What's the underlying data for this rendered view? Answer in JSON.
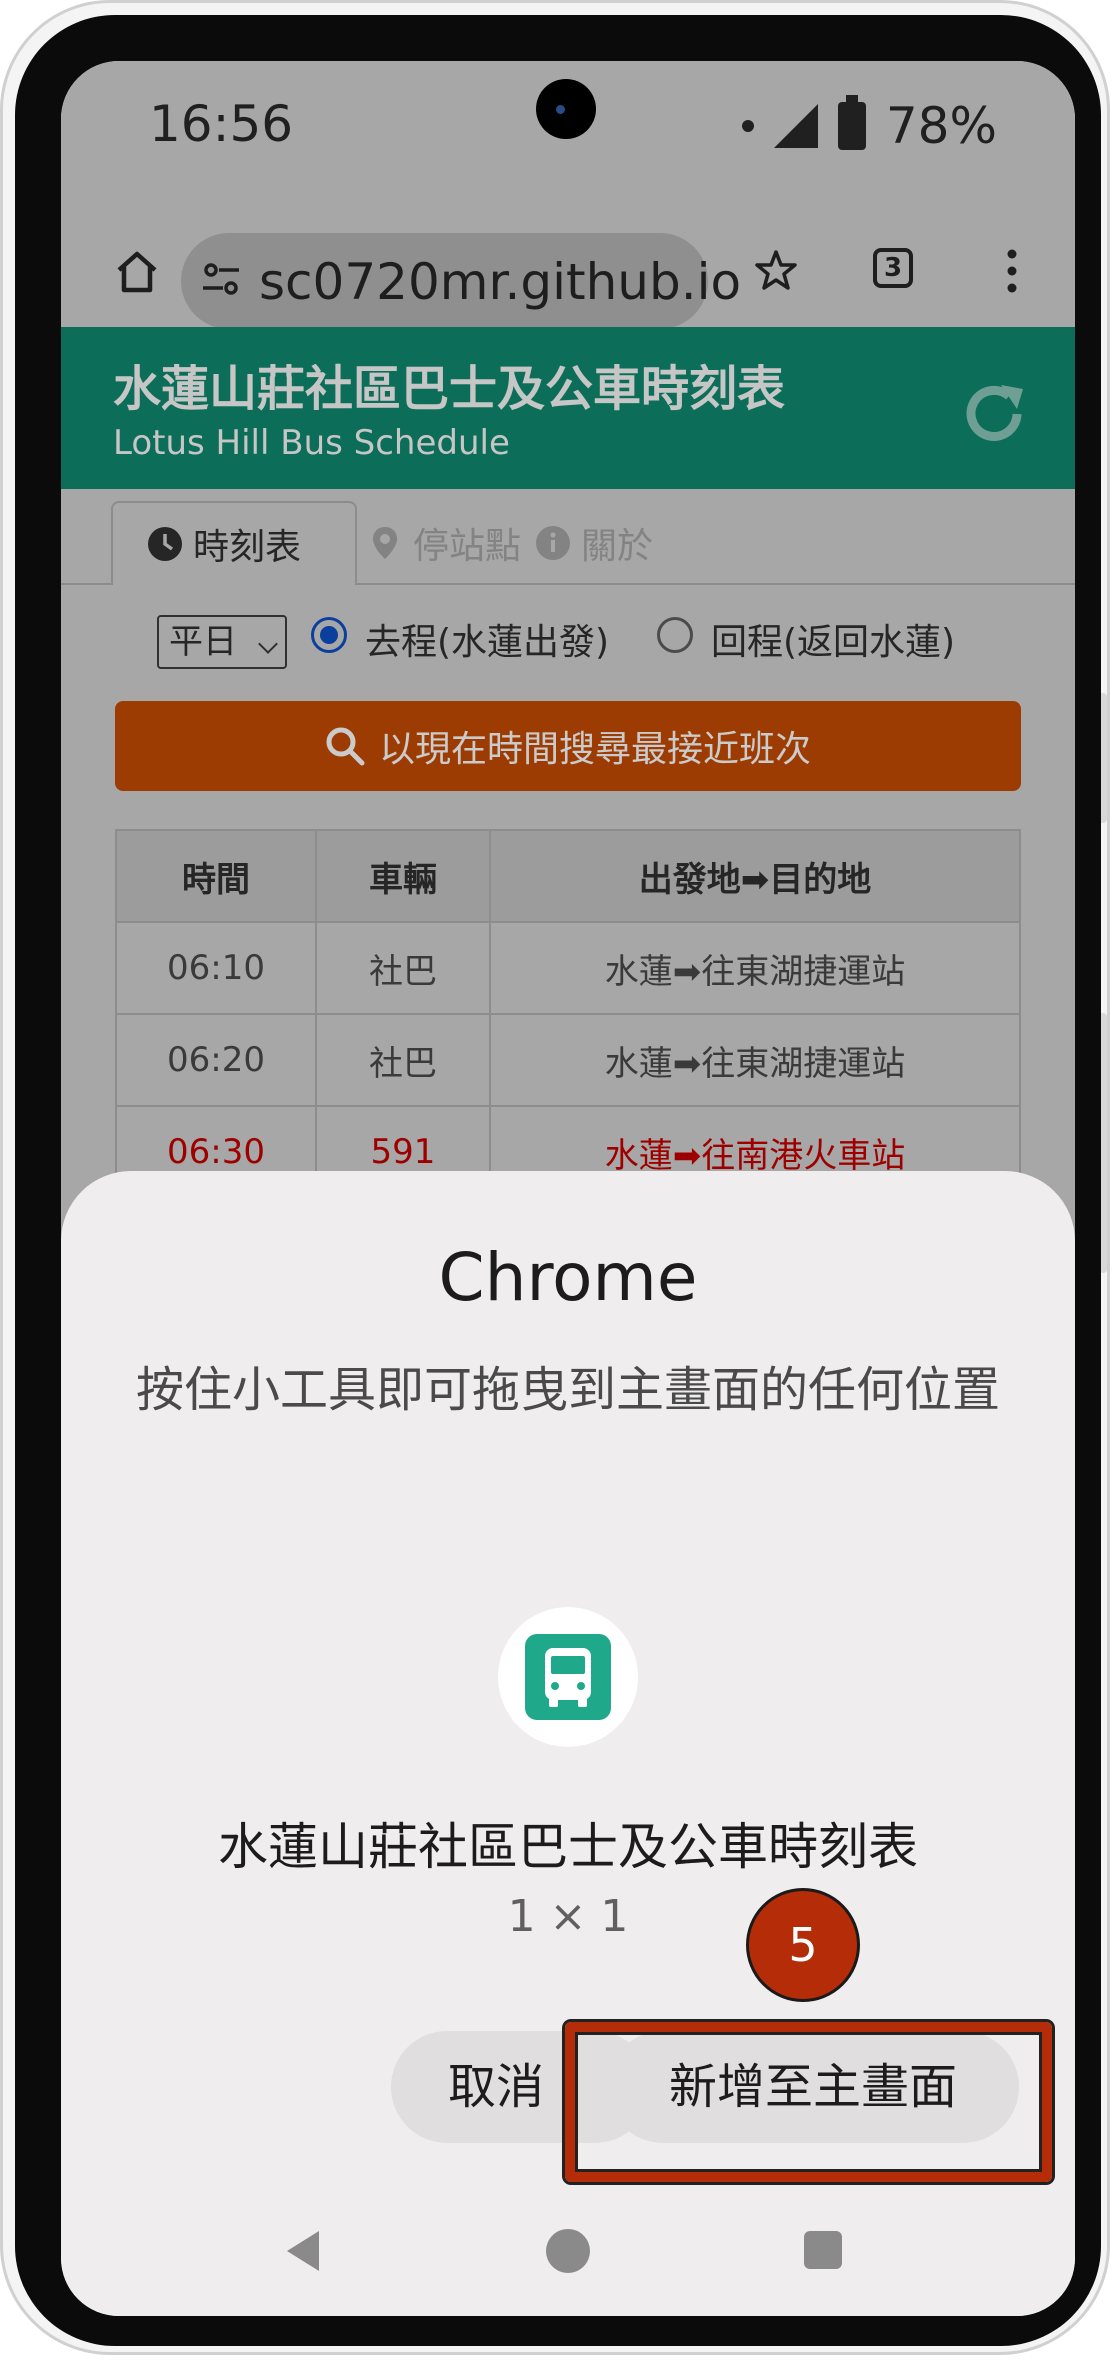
{
  "status_bar": {
    "time": "16:56",
    "battery": "78%"
  },
  "browser": {
    "url": "sc0720mr.github.io",
    "tab_count": "3"
  },
  "site": {
    "title": "水蓮山莊社區巴士及公車時刻表",
    "subtitle": "Lotus Hill Bus Schedule",
    "tabs": [
      {
        "label": "時刻表"
      },
      {
        "label": "停站點"
      },
      {
        "label": "關於"
      }
    ]
  },
  "controls": {
    "day_select": "平日",
    "radio_outbound": "去程(水蓮出發)",
    "radio_return": "回程(返回水蓮)",
    "search_button": "以現在時間搜尋最接近班次"
  },
  "schedule": {
    "headers": [
      "時間",
      "車輛",
      "出發地➡目的地"
    ],
    "rows": [
      [
        "06:10",
        "社巴",
        "水蓮➡往東湖捷運站"
      ],
      [
        "06:20",
        "社巴",
        "水蓮➡往東湖捷運站"
      ],
      [
        "06:30",
        "591",
        "水蓮➡往南港火車站"
      ]
    ]
  },
  "sheet": {
    "title": "Chrome",
    "description": "按住小工具即可拖曳到主畫面的任何位置",
    "widget_name": "水蓮山莊社區巴士及公車時刻表",
    "widget_size": "1 × 1",
    "cancel": "取消",
    "add": "新增至主畫面"
  },
  "annotation": {
    "step": "5",
    "color": "#b42c08"
  },
  "colors": {
    "header_bg": "#0c6e58",
    "search_btn": "#9c3c03",
    "widget_icon": "#1fa98a"
  }
}
